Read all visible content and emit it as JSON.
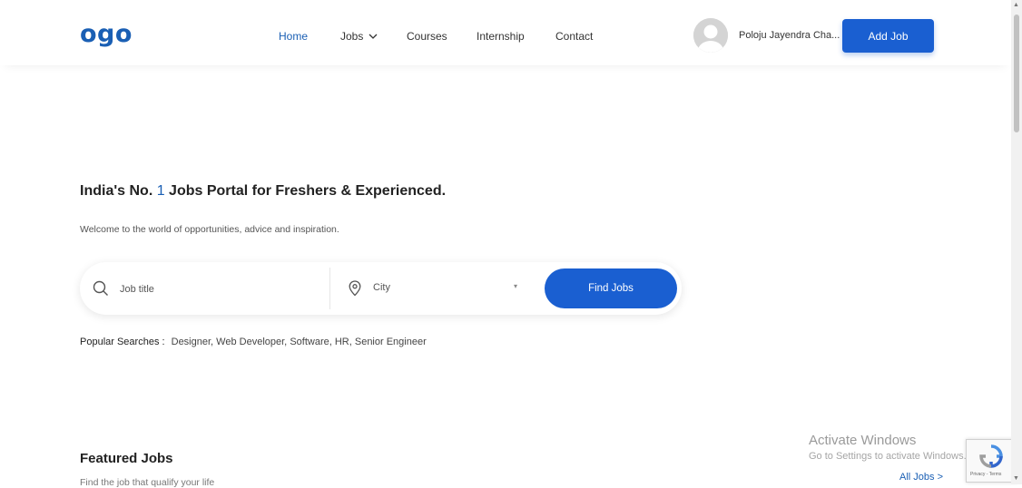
{
  "header": {
    "logo": "ogo",
    "nav": [
      "Home",
      "Jobs",
      "Courses",
      "Internship",
      "Contact"
    ],
    "user_name": "Poloju Jayendra Cha...",
    "add_job": "Add Job"
  },
  "hero": {
    "headline_pre": "India's No. ",
    "headline_num": "1",
    "headline_post": " Jobs Portal for Freshers & Experienced.",
    "subtitle": "Welcome to the world of opportunities, advice and inspiration."
  },
  "search": {
    "job_placeholder": "Job title",
    "city": "City",
    "button": "Find Jobs"
  },
  "popular": {
    "label": "Popular Searches :",
    "tags": [
      "Designer,",
      "Web Developer,",
      "Software,",
      "HR,",
      "Senior Engineer"
    ]
  },
  "featured": {
    "title": "Featured Jobs",
    "subtitle": "Find the job that qualify your life",
    "all_jobs": "All Jobs >"
  },
  "watermark": {
    "line1": "Activate Windows",
    "line2": "Go to Settings to activate Windows."
  },
  "recaptcha": {
    "text": "Privacy - Terms"
  },
  "colors": {
    "accent": "#1a5fd1",
    "logo": "#1a5fb4"
  }
}
